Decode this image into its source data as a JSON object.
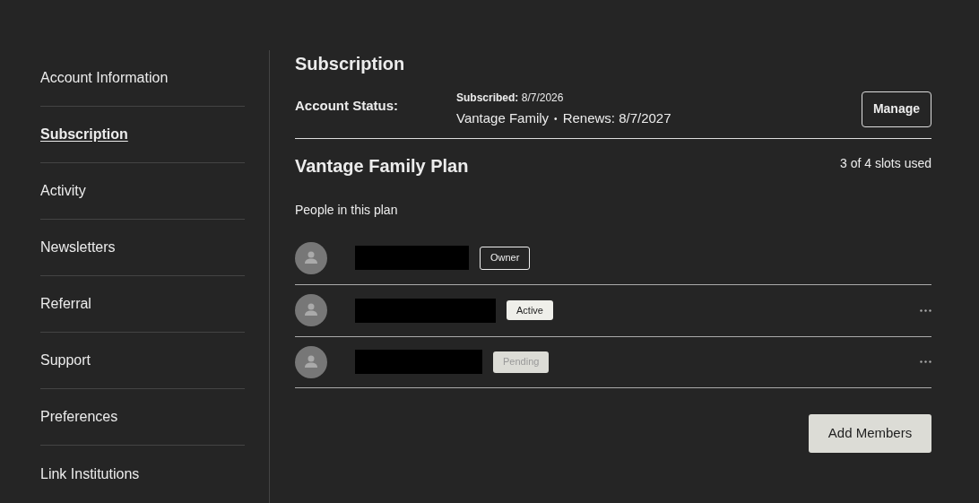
{
  "sidebar": {
    "items": [
      {
        "label": "Account Information",
        "selected": false
      },
      {
        "label": "Subscription",
        "selected": true
      },
      {
        "label": "Activity",
        "selected": false
      },
      {
        "label": "Newsletters",
        "selected": false
      },
      {
        "label": "Referral",
        "selected": false
      },
      {
        "label": "Support",
        "selected": false
      },
      {
        "label": "Preferences",
        "selected": false
      },
      {
        "label": "Link Institutions",
        "selected": false
      }
    ]
  },
  "title": "Subscription",
  "account_status": {
    "label": "Account Status:",
    "subscribed_label": "Subscribed:",
    "subscribed_date": "8/7/2026",
    "plan": "Vantage Family",
    "separator": "•",
    "renews": "Renews: 8/7/2027",
    "button": "Manage"
  },
  "plan": {
    "title": "Vantage Family Plan",
    "slots": "3 of 4 slots used",
    "people_label": "People in this plan"
  },
  "members": [
    {
      "badge": "Owner",
      "kind": "owner",
      "menu": false
    },
    {
      "badge": "Active",
      "kind": "active",
      "menu": true
    },
    {
      "badge": "Pending",
      "kind": "pending",
      "menu": true
    }
  ],
  "add_button": "Add Members"
}
